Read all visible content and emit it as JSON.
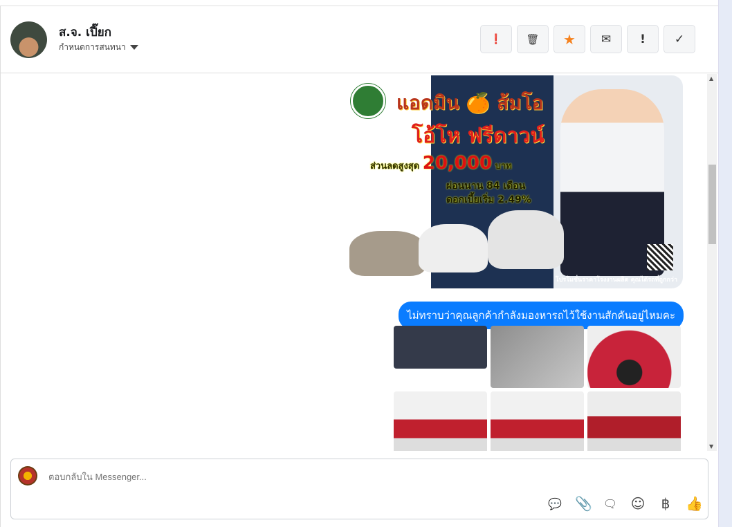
{
  "header": {
    "name": "ส.จ. เปี๊ยก",
    "assign_label": "กำหนดการสนทนา",
    "actions": [
      {
        "icon": "exclamation-circle-icon",
        "glyph": "❗"
      },
      {
        "icon": "trash-icon",
        "glyph": "🗑"
      },
      {
        "icon": "star-icon",
        "glyph": "★",
        "color": "#f5821f"
      },
      {
        "icon": "envelope-icon",
        "glyph": "✉"
      },
      {
        "icon": "exclamation-icon",
        "glyph": "!"
      },
      {
        "icon": "check-icon",
        "glyph": "✓"
      }
    ]
  },
  "messages": {
    "banner": {
      "title": "แอดมิน 🍊 ส้มโอ",
      "headline": "โอ้โห ฟรีดาวน์",
      "discount_label": "ส่วนลดสูงสุด",
      "discount_amount": "20,000",
      "currency": "บาท",
      "installment": "ผ่อนนาน 84 เดือน",
      "interest": "ดอกเบี้ยเริ่ม 2.49%",
      "footer": "โปรโมชั่นราคาโรงงานผลิต คุณได้รถที่ถูกกว่า"
    },
    "bubble": "ไม่ทราบว่าคุณลูกค้ากำลังมองหารถไว้ใช้งานสักคันอยู่ไหมคะ"
  },
  "composer": {
    "placeholder": "ตอบกลับใน Messenger...",
    "currency_glyph": "฿",
    "accent": "#0a7cff"
  }
}
